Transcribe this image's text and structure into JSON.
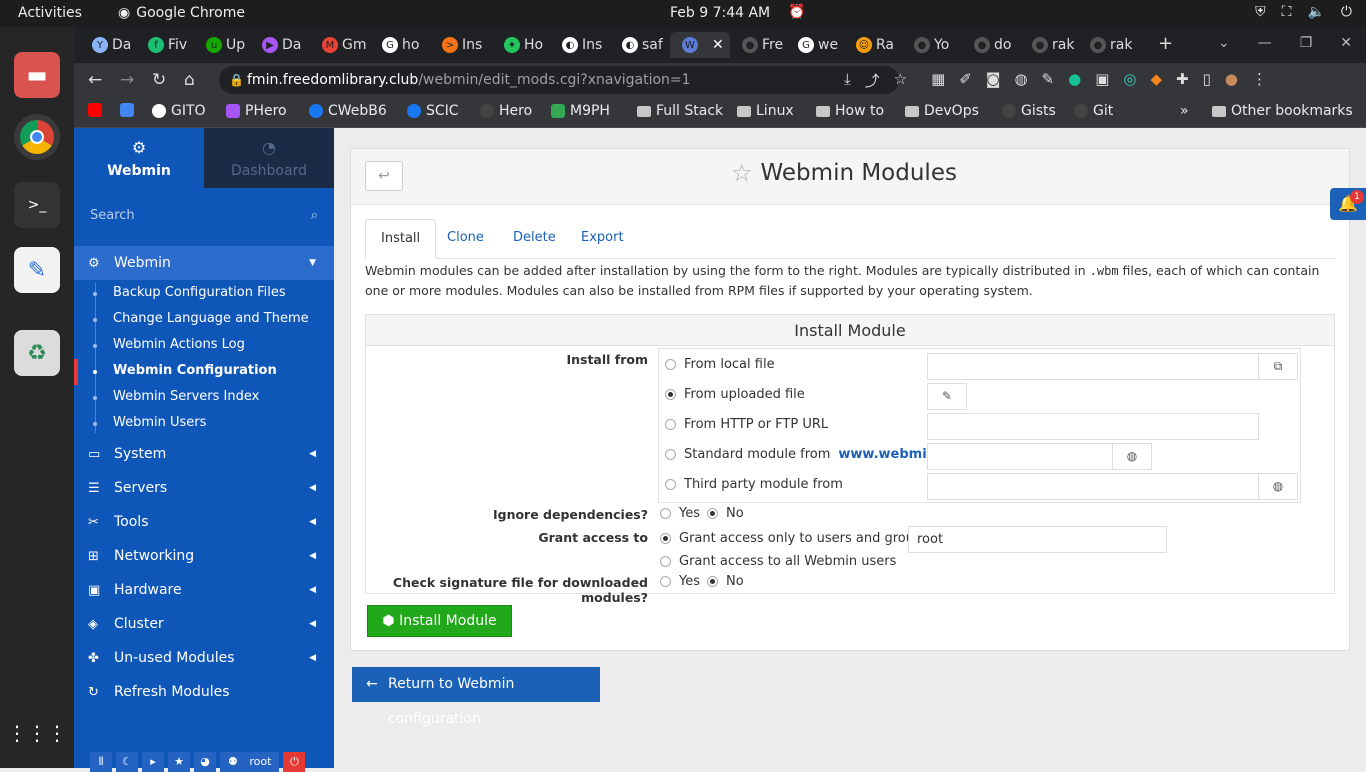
{
  "system_bar": {
    "activities": "Activities",
    "app_name": "Google Chrome",
    "clock": "Feb 9  7:44 AM"
  },
  "tabs": [
    {
      "label": "Da"
    },
    {
      "label": "Fiv"
    },
    {
      "label": "Up"
    },
    {
      "label": "Da"
    },
    {
      "label": "Gm"
    },
    {
      "label": "ho"
    },
    {
      "label": "Ins"
    },
    {
      "label": "Ho"
    },
    {
      "label": "Ins"
    },
    {
      "label": "saf"
    },
    {
      "label": ""
    },
    {
      "label": "Fre"
    },
    {
      "label": "we"
    },
    {
      "label": "Ra"
    },
    {
      "label": "Yo"
    },
    {
      "label": "do"
    },
    {
      "label": "rak"
    },
    {
      "label": "rak"
    }
  ],
  "address_bar": {
    "host": "fmin.freedomlibrary.club",
    "path": "/webmin/edit_mods.cgi?xnavigation=1"
  },
  "bookmarks": [
    {
      "label": "GITO"
    },
    {
      "label": "PHero"
    },
    {
      "label": "CWebB6"
    },
    {
      "label": "SCIC"
    },
    {
      "label": "Hero"
    },
    {
      "label": "M9PH"
    },
    {
      "label": "Full Stack"
    },
    {
      "label": "Linux"
    },
    {
      "label": "How to"
    },
    {
      "label": "DevOps"
    },
    {
      "label": "Gists"
    },
    {
      "label": "Git"
    },
    {
      "label": "»"
    },
    {
      "label": "Other bookmarks"
    }
  ],
  "sidebar": {
    "tab_webmin": "Webmin",
    "tab_dashboard": "Dashboard",
    "search_placeholder": "Search",
    "categories": [
      {
        "label": "Webmin"
      },
      {
        "label": "System"
      },
      {
        "label": "Servers"
      },
      {
        "label": "Tools"
      },
      {
        "label": "Networking"
      },
      {
        "label": "Hardware"
      },
      {
        "label": "Cluster"
      },
      {
        "label": "Un-used Modules"
      },
      {
        "label": "Refresh Modules"
      }
    ],
    "webmin_items": [
      {
        "label": "Backup Configuration Files"
      },
      {
        "label": "Change Language and Theme"
      },
      {
        "label": "Webmin Actions Log"
      },
      {
        "label": "Webmin Configuration"
      },
      {
        "label": "Webmin Servers Index"
      },
      {
        "label": "Webmin Users"
      }
    ],
    "bottom_user": "root"
  },
  "page": {
    "title": "Webmin Modules",
    "tabs": [
      {
        "label": "Install"
      },
      {
        "label": "Clone"
      },
      {
        "label": "Delete"
      },
      {
        "label": "Export"
      }
    ],
    "desc_pre": "Webmin modules can be added after installation by using the form to the right. Modules are typically distributed in ",
    "desc_code": ".wbm",
    "desc_post": " files, each of which can contain one or more modules. Modules can also be installed from RPM files if supported by your operating system.",
    "form_title": "Install Module",
    "install_from_label": "Install from",
    "options": {
      "local": "From local file",
      "uploaded": "From uploaded file",
      "url": "From HTTP or FTP URL",
      "standard": "Standard module from",
      "standard_link": "www.webmin.com",
      "third": "Third party module from"
    },
    "ignore_label": "Ignore dependencies?",
    "yes": "Yes",
    "no": "No",
    "grant_label": "Grant access to",
    "grant_only": "Grant access only to users and groups :",
    "grant_value": "root",
    "grant_all": "Grant access to all Webmin users",
    "check_label": "Check signature file for downloaded modules?",
    "install_button": "Install Module",
    "return_button": "Return to Webmin configuration",
    "notification_count": "1"
  }
}
